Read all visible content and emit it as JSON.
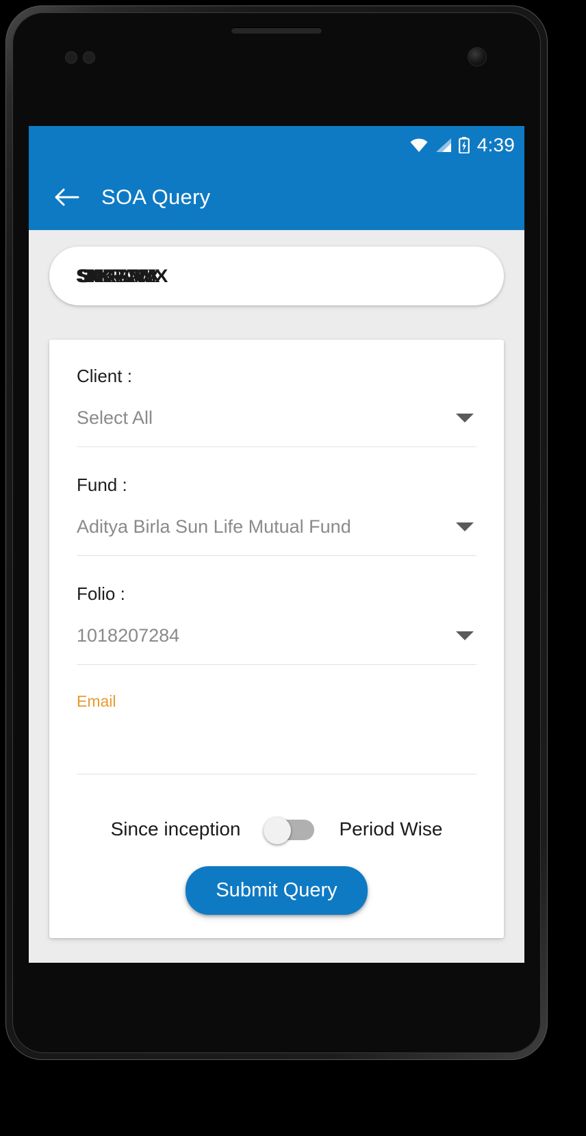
{
  "status_bar": {
    "time": "4:39",
    "wifi_icon": "wifi-icon",
    "signal_icon": "cellular-signal-icon",
    "battery_icon": "battery-charging-icon"
  },
  "app_bar": {
    "back_icon": "back-arrow-icon",
    "title": "SOA Query"
  },
  "theme": {
    "primary": "#0f7ac4",
    "background": "#ececec",
    "card": "#ffffff",
    "accent_orange": "#e8992f",
    "muted_text": "#8a8a8a"
  },
  "name_field": {
    "value": "SKKRAMX",
    "note": "redacted"
  },
  "form": {
    "client": {
      "label": "Client :",
      "value": "Select All",
      "caret_icon": "chevron-down-icon"
    },
    "fund": {
      "label": "Fund :",
      "value": "Aditya Birla Sun Life Mutual Fund",
      "caret_icon": "chevron-down-icon"
    },
    "folio": {
      "label": "Folio :",
      "value": "1018207284",
      "caret_icon": "chevron-down-icon"
    },
    "email": {
      "label": "Email",
      "value": "",
      "placeholder": ""
    }
  },
  "toggle": {
    "left_label": "Since inception",
    "right_label": "Period Wise",
    "state": "off"
  },
  "submit": {
    "label": "Submit Query"
  },
  "nav_bar": {
    "back_icon": "nav-back-icon",
    "home_icon": "nav-home-icon",
    "recents_icon": "nav-recents-icon"
  }
}
